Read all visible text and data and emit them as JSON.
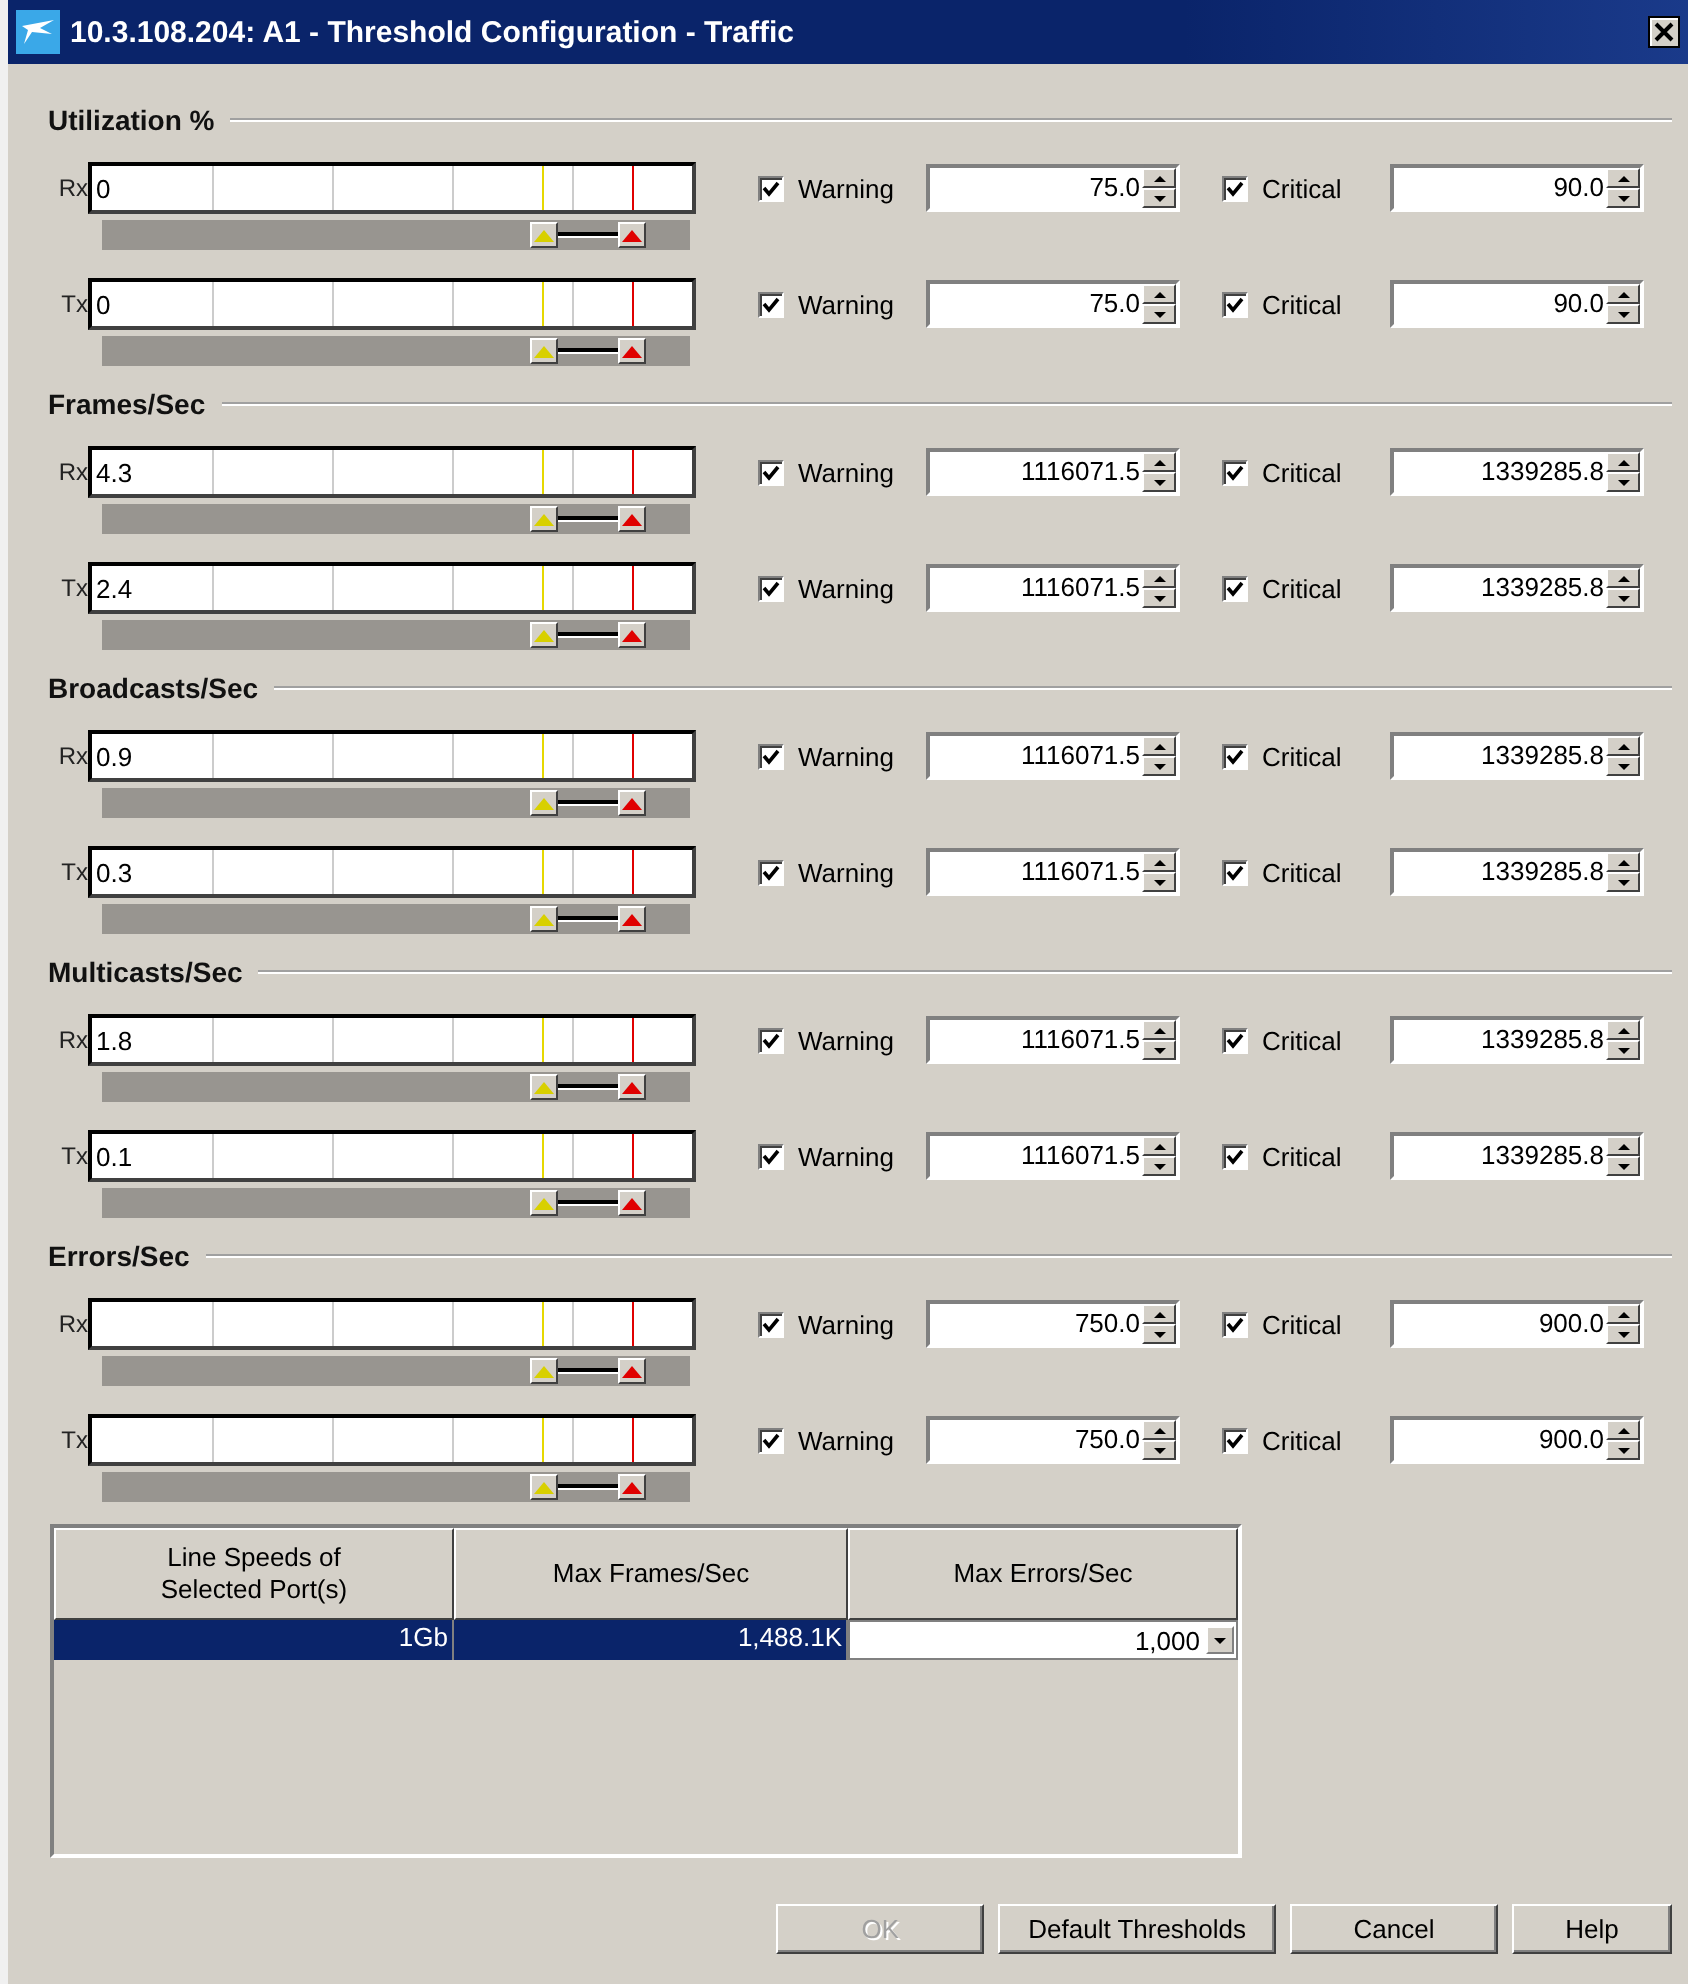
{
  "window": {
    "title": "10.3.108.204: A1 - Threshold Configuration - Traffic"
  },
  "sections": [
    {
      "title": "Utilization %",
      "rows": [
        {
          "label": "Rx",
          "value": "0",
          "warning_marker": {
            "level": 0.75
          },
          "critical_marker": {
            "level": 0.9
          },
          "warning": {
            "label": "Warning",
            "checked": true,
            "value": "75.0"
          },
          "critical": {
            "label": "Critical",
            "checked": true,
            "value": "90.0"
          }
        },
        {
          "label": "Tx",
          "value": "0",
          "warning_marker": {
            "level": 0.75
          },
          "critical_marker": {
            "level": 0.9
          },
          "warning": {
            "label": "Warning",
            "checked": true,
            "value": "75.0"
          },
          "critical": {
            "label": "Critical",
            "checked": true,
            "value": "90.0"
          }
        }
      ]
    },
    {
      "title": "Frames/Sec",
      "rows": [
        {
          "label": "Rx",
          "value": "4.3",
          "warning_marker": {
            "level": 0.75
          },
          "critical_marker": {
            "level": 0.9
          },
          "warning": {
            "label": "Warning",
            "checked": true,
            "value": "1116071.5"
          },
          "critical": {
            "label": "Critical",
            "checked": true,
            "value": "1339285.8"
          }
        },
        {
          "label": "Tx",
          "value": "2.4",
          "warning_marker": {
            "level": 0.75
          },
          "critical_marker": {
            "level": 0.9
          },
          "warning": {
            "label": "Warning",
            "checked": true,
            "value": "1116071.5"
          },
          "critical": {
            "label": "Critical",
            "checked": true,
            "value": "1339285.8"
          }
        }
      ]
    },
    {
      "title": "Broadcasts/Sec",
      "rows": [
        {
          "label": "Rx",
          "value": "0.9",
          "warning_marker": {
            "level": 0.75
          },
          "critical_marker": {
            "level": 0.9
          },
          "warning": {
            "label": "Warning",
            "checked": true,
            "value": "1116071.5"
          },
          "critical": {
            "label": "Critical",
            "checked": true,
            "value": "1339285.8"
          }
        },
        {
          "label": "Tx",
          "value": "0.3",
          "warning_marker": {
            "level": 0.75
          },
          "critical_marker": {
            "level": 0.9
          },
          "warning": {
            "label": "Warning",
            "checked": true,
            "value": "1116071.5"
          },
          "critical": {
            "label": "Critical",
            "checked": true,
            "value": "1339285.8"
          }
        }
      ]
    },
    {
      "title": "Multicasts/Sec",
      "rows": [
        {
          "label": "Rx",
          "value": "1.8",
          "warning_marker": {
            "level": 0.75
          },
          "critical_marker": {
            "level": 0.9
          },
          "warning": {
            "label": "Warning",
            "checked": true,
            "value": "1116071.5"
          },
          "critical": {
            "label": "Critical",
            "checked": true,
            "value": "1339285.8"
          }
        },
        {
          "label": "Tx",
          "value": "0.1",
          "warning_marker": {
            "level": 0.75
          },
          "critical_marker": {
            "level": 0.9
          },
          "warning": {
            "label": "Warning",
            "checked": true,
            "value": "1116071.5"
          },
          "critical": {
            "label": "Critical",
            "checked": true,
            "value": "1339285.8"
          }
        }
      ]
    },
    {
      "title": "Errors/Sec",
      "rows": [
        {
          "label": "Rx",
          "warning_marker": {
            "level": 0.75
          },
          "critical_marker": {
            "level": 0.9
          },
          "warning": {
            "label": "Warning",
            "checked": true,
            "value": "750.0"
          },
          "critical": {
            "label": "Critical",
            "checked": true,
            "value": "900.0"
          }
        },
        {
          "label": "Tx",
          "warning_marker": {
            "level": 0.75
          },
          "critical_marker": {
            "level": 0.9
          },
          "warning": {
            "label": "Warning",
            "checked": true,
            "value": "750.0"
          },
          "critical": {
            "label": "Critical",
            "checked": true,
            "value": "900.0"
          }
        }
      ]
    }
  ],
  "table": {
    "columns": [
      "Line Speeds of Selected Port(s)",
      "Max Frames/Sec",
      "Max Errors/Sec"
    ],
    "rows": [
      {
        "selected": true,
        "cells": [
          "1Gb",
          "1,488.1K",
          "1,000"
        ]
      }
    ]
  },
  "buttons": [
    {
      "label": "OK",
      "disabled": true
    },
    {
      "label": "Default Thresholds",
      "disabled": false
    },
    {
      "label": "Cancel",
      "disabled": false
    },
    {
      "label": "Help",
      "disabled": false
    }
  ]
}
